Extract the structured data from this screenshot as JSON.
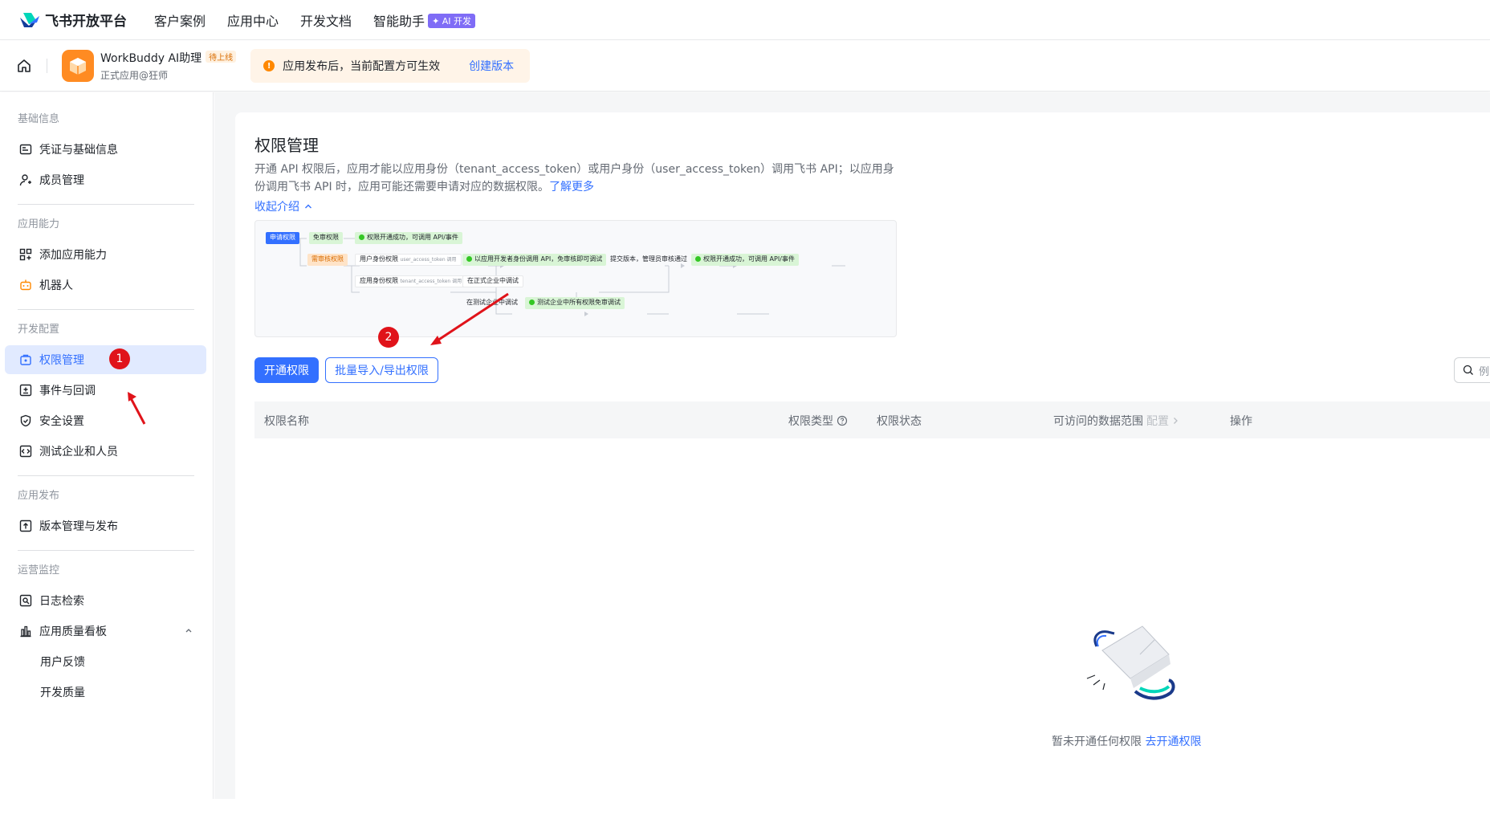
{
  "topnav": {
    "brand": "飞书开放平台",
    "links": [
      "客户案例",
      "应用中心",
      "开发文档",
      "智能助手"
    ],
    "ai_badge": "✦ AI 开发"
  },
  "app_header": {
    "app_name": "WorkBuddy AI助理",
    "app_tag": "待上线",
    "app_sub": "正式应用@狂师",
    "notice_text": "应用发布后，当前配置方可生效",
    "notice_link": "创建版本"
  },
  "sidebar": {
    "groups": [
      {
        "title": "基础信息",
        "items": [
          "凭证与基础信息",
          "成员管理"
        ]
      },
      {
        "title": "应用能力",
        "items": [
          "添加应用能力",
          "机器人"
        ]
      },
      {
        "title": "开发配置",
        "items": [
          "权限管理",
          "事件与回调",
          "安全设置",
          "测试企业和人员"
        ]
      },
      {
        "title": "应用发布",
        "items": [
          "版本管理与发布"
        ]
      },
      {
        "title": "运营监控",
        "items": [
          "日志检索",
          "应用质量看板",
          "用户反馈",
          "开发质量"
        ]
      }
    ],
    "active_item": "权限管理"
  },
  "main": {
    "title": "权限管理",
    "desc": "开通 API 权限后，应用才能以应用身份（tenant_access_token）或用户身份（user_access_token）调用飞书 API；以应用身份调用飞书 API 时，应用可能还需要申请对应的数据权限。",
    "desc_link": "了解更多",
    "collapse": "收起介绍",
    "flow": {
      "apply": "申请权限",
      "free": "免审权限",
      "free_result": "权限开通成功，可调用 API/事件",
      "review": "需审核权限",
      "user_perm": "用户身份权限",
      "user_token": "user_access_token 调用",
      "dev_call": "以应用开发者身份调用 API，免审核即可调试",
      "app_perm": "应用身份权限",
      "tenant_token": "tenant_access_token 调用",
      "prod_debug": "在正式企业中调试",
      "submit": "提交版本，管理员审核通过",
      "final_result": "权限开通成功，可调用 API/事件",
      "test_debug": "在测试企业中调试",
      "test_result": "测试企业中所有权限免审调试"
    },
    "btn_open": "开通权限",
    "btn_batch": "批量导入/导出权限",
    "search_placeholder": "例",
    "columns": {
      "name": "权限名称",
      "type": "权限类型",
      "status": "权限状态",
      "scope": "可访问的数据范围",
      "scope_cfg": "配置",
      "ops": "操作"
    },
    "empty_text": "暂未开通任何权限",
    "empty_link": "去开通权限"
  },
  "annotations": {
    "marker1": "1",
    "marker2": "2"
  },
  "colors": {
    "accent": "#3370ff",
    "marker": "#e0131a",
    "app_logo": "#ff8b22"
  }
}
